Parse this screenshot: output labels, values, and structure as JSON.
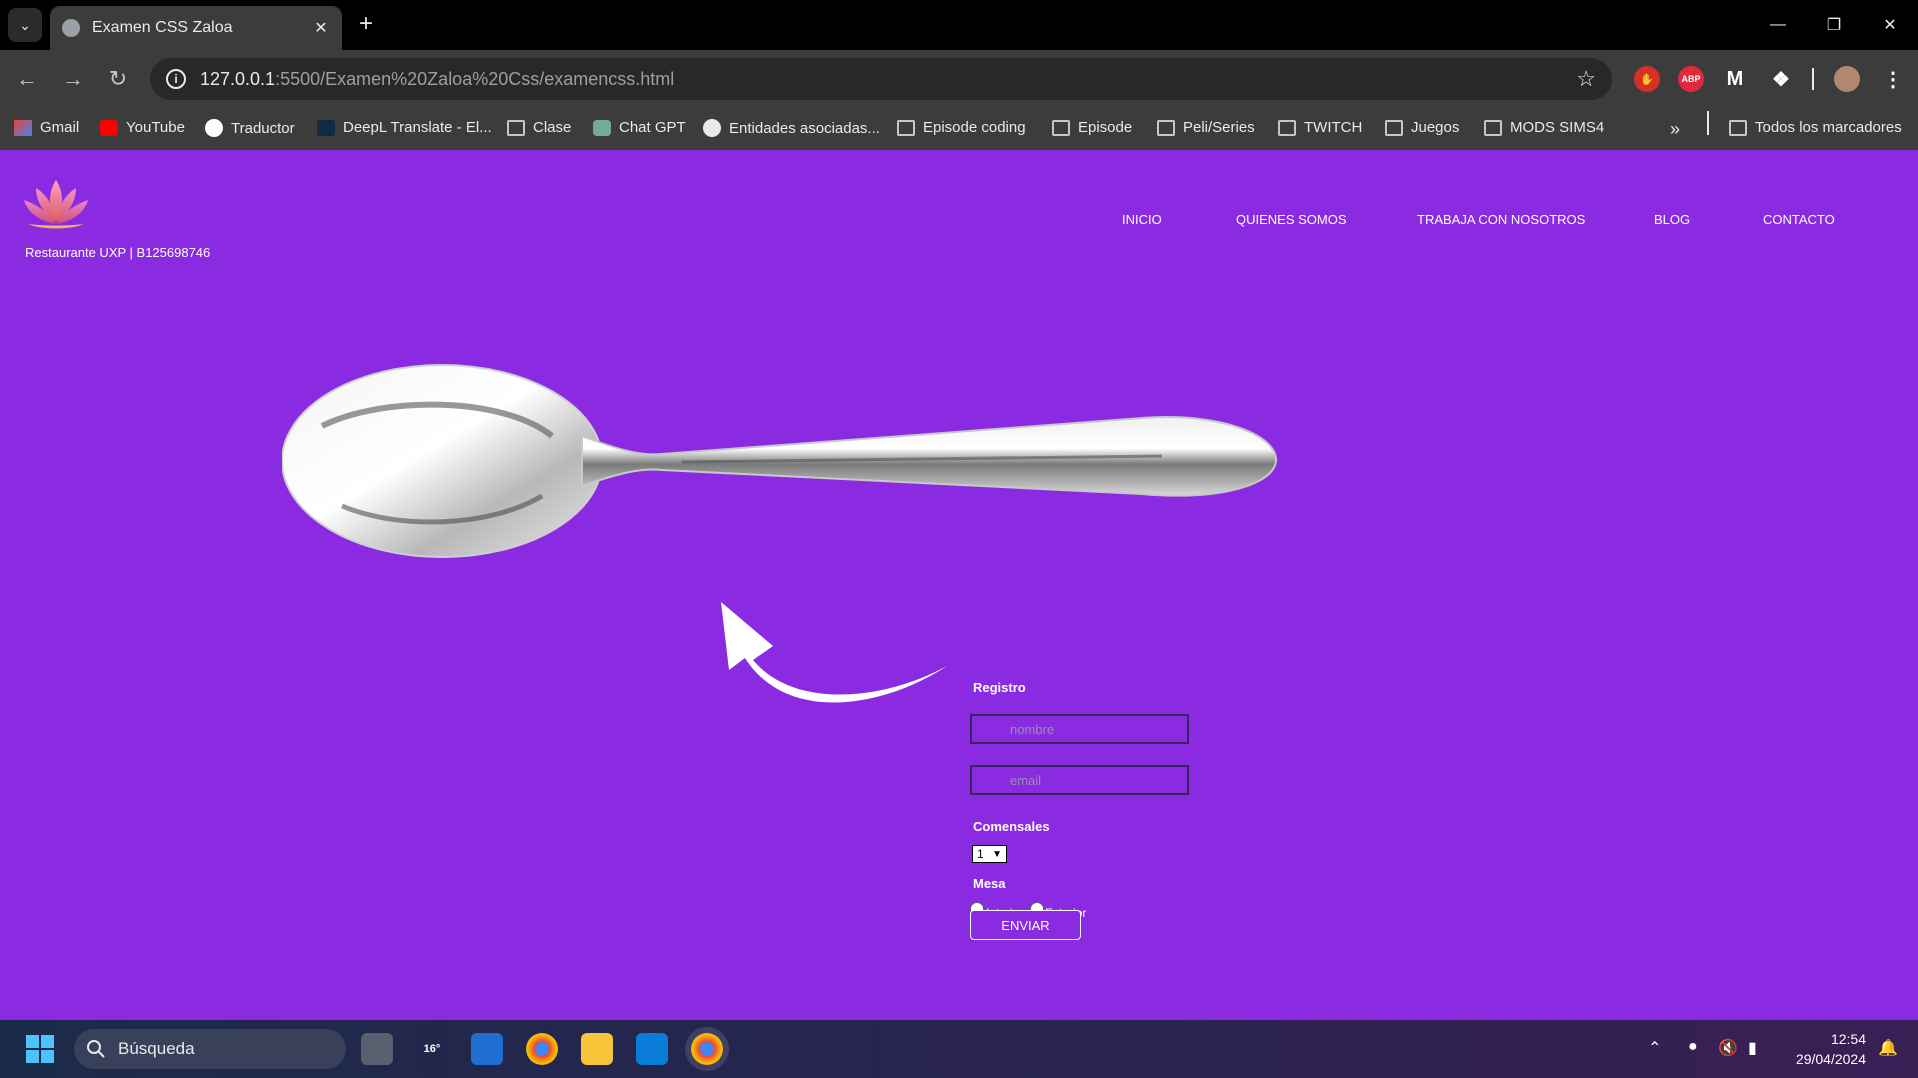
{
  "browser": {
    "tab_title": "Examen CSS Zaloa",
    "url_host": "127.0.0.1",
    "url_path": ":5500/Examen%20Zaloa%20Css/examencss.html",
    "extensions": [
      "ABP"
    ],
    "bookmarks": [
      {
        "label": "Gmail",
        "icon": "gmail-icon"
      },
      {
        "label": "YouTube",
        "icon": "youtube-icon"
      },
      {
        "label": "Traductor",
        "icon": "google-icon"
      },
      {
        "label": "DeepL Translate - El...",
        "icon": "deepl-icon"
      },
      {
        "label": "Clase",
        "icon": "folder-icon"
      },
      {
        "label": "Chat GPT",
        "icon": "chatgpt-icon"
      },
      {
        "label": "Entidades asociadas...",
        "icon": "globe-icon"
      },
      {
        "label": "Episode coding",
        "icon": "folder-icon"
      },
      {
        "label": "Episode",
        "icon": "folder-icon"
      },
      {
        "label": "Peli/Series",
        "icon": "folder-icon"
      },
      {
        "label": "TWITCH",
        "icon": "folder-icon"
      },
      {
        "label": "Juegos",
        "icon": "folder-icon"
      },
      {
        "label": "MODS SIMS4",
        "icon": "folder-icon"
      }
    ],
    "all_bookmarks": "Todos los marcadores"
  },
  "page": {
    "background_color": "#8a2be2",
    "company": "Restaurante UXP | B125698746",
    "nav": [
      "INICIO",
      "QUIENES SOMOS",
      "TRABAJA CON NOSOTROS",
      "BLOG",
      "CONTACTO"
    ],
    "form": {
      "title": "Registro",
      "name_placeholder": "nombre",
      "email_placeholder": "email",
      "guests_label": "Comensales",
      "guests_value": "1",
      "table_label": "Mesa",
      "option_interior": "Interior",
      "option_exterior": "Exterior",
      "submit": "ENVIAR"
    }
  },
  "taskbar": {
    "search_placeholder": "Búsqueda",
    "weather_temp": "16°",
    "time": "12:54",
    "date": "29/04/2024"
  }
}
